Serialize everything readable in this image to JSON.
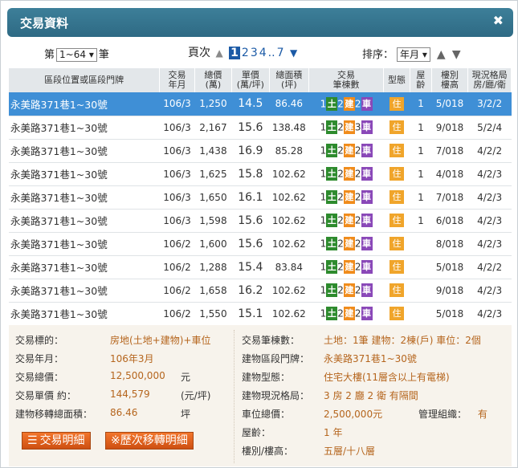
{
  "dialog": {
    "title": "交易資料",
    "close_icon": "close-icon"
  },
  "toolbar": {
    "range_prefix": "第",
    "range_value": "1~64",
    "range_suffix": "筆",
    "pages_label": "頁次",
    "pages": [
      "1",
      "2",
      "3",
      "4",
      "..",
      "7"
    ],
    "current_page": "1",
    "sort_label": "排序：",
    "sort_value": "年月"
  },
  "table": {
    "headers": {
      "address": "區段位置或區段門牌",
      "date": "交易\n年月",
      "total": "總價\n(萬)",
      "unit": "單價\n(萬/坪)",
      "area": "總面積\n(坪)",
      "counts": "交易\n筆棟數",
      "type": "型態",
      "age": "屋\n齡",
      "floor": "樓別\n樓高",
      "layout": "現況格局\n房/廳/衛"
    },
    "rows": [
      {
        "address": "永美路371巷1~30號",
        "date": "106/3",
        "total": "1,250",
        "unit": "14.5",
        "area": "86.46",
        "land": "1",
        "bld": "2",
        "car": "2",
        "type": "住",
        "age": "1",
        "floor": "5/018",
        "layout": "3/2/2",
        "selected": true
      },
      {
        "address": "永美路371巷1~30號",
        "date": "106/3",
        "total": "2,167",
        "unit": "15.6",
        "area": "138.48",
        "land": "1",
        "bld": "2",
        "car": "3",
        "type": "住",
        "age": "1",
        "floor": "9/018",
        "layout": "5/2/4",
        "selected": false
      },
      {
        "address": "永美路371巷1~30號",
        "date": "106/3",
        "total": "1,438",
        "unit": "16.9",
        "area": "85.28",
        "land": "1",
        "bld": "2",
        "car": "2",
        "type": "住",
        "age": "1",
        "floor": "7/018",
        "layout": "4/2/2",
        "selected": false
      },
      {
        "address": "永美路371巷1~30號",
        "date": "106/3",
        "total": "1,625",
        "unit": "15.8",
        "area": "102.62",
        "land": "1",
        "bld": "2",
        "car": "2",
        "type": "住",
        "age": "1",
        "floor": "4/018",
        "layout": "4/2/3",
        "selected": false
      },
      {
        "address": "永美路371巷1~30號",
        "date": "106/3",
        "total": "1,650",
        "unit": "16.1",
        "area": "102.62",
        "land": "1",
        "bld": "2",
        "car": "2",
        "type": "住",
        "age": "1",
        "floor": "7/018",
        "layout": "4/2/3",
        "selected": false
      },
      {
        "address": "永美路371巷1~30號",
        "date": "106/3",
        "total": "1,598",
        "unit": "15.6",
        "area": "102.62",
        "land": "1",
        "bld": "2",
        "car": "2",
        "type": "住",
        "age": "1",
        "floor": "6/018",
        "layout": "4/2/3",
        "selected": false
      },
      {
        "address": "永美路371巷1~30號",
        "date": "106/2",
        "total": "1,600",
        "unit": "15.6",
        "area": "102.62",
        "land": "1",
        "bld": "2",
        "car": "2",
        "type": "住",
        "age": "",
        "floor": "8/018",
        "layout": "4/2/3",
        "selected": false
      },
      {
        "address": "永美路371巷1~30號",
        "date": "106/2",
        "total": "1,288",
        "unit": "15.4",
        "area": "83.84",
        "land": "1",
        "bld": "2",
        "car": "2",
        "type": "住",
        "age": "",
        "floor": "5/018",
        "layout": "4/2/2",
        "selected": false
      },
      {
        "address": "永美路371巷1~30號",
        "date": "106/2",
        "total": "1,658",
        "unit": "16.2",
        "area": "102.62",
        "land": "1",
        "bld": "2",
        "car": "2",
        "type": "住",
        "age": "",
        "floor": "9/018",
        "layout": "4/2/3",
        "selected": false
      },
      {
        "address": "永美路371巷1~30號",
        "date": "106/2",
        "total": "1,550",
        "unit": "15.1",
        "area": "102.62",
        "land": "1",
        "bld": "2",
        "car": "2",
        "type": "住",
        "age": "",
        "floor": "5/018",
        "layout": "4/2/3",
        "selected": false
      }
    ],
    "badge_letters": {
      "land": "土",
      "bld": "建",
      "car": "車"
    }
  },
  "detail": {
    "left": [
      {
        "label": "交易標的：",
        "value": "房地(土地+建物)+車位",
        "unit": ""
      },
      {
        "label": "交易年月：",
        "value": "106年3月",
        "unit": ""
      },
      {
        "label": "交易總價：",
        "value": "12,500,000",
        "unit": "元"
      },
      {
        "label": "交易單價 約：",
        "value": "144,579",
        "unit": "(元/坪)"
      },
      {
        "label": "建物移轉總面積：",
        "value": "86.46",
        "unit": "坪"
      }
    ],
    "right": [
      {
        "label": "交易筆棟數：",
        "value": "土地：1筆 建物：2棟(戶) 車位：2個"
      },
      {
        "label": "建物區段門牌：",
        "value": "永美路371巷1~30號"
      },
      {
        "label": "建物型態：",
        "value": "住宅大樓(11層含以上有電梯)"
      },
      {
        "label": "建物現況格局：",
        "value": "3 房 2 廳 2 衛 有隔間"
      },
      {
        "label": "車位總價：",
        "value": "2,500,000元"
      },
      {
        "label": "屋齡：",
        "value": "1 年"
      },
      {
        "label": "樓別/樓高：",
        "value": "五層/十八層"
      }
    ],
    "mgmt_label": "管理組織：",
    "mgmt_value": "有",
    "buttons": {
      "detail": "交易明細",
      "history": "※歷次移轉明細"
    }
  },
  "colors": {
    "title_bar": "#2e6a84",
    "selected_row": "#3f8fd6",
    "land_badge": "#2e8b2e",
    "building_badge": "#f08c1c",
    "parking_badge": "#8a48b8",
    "type_badge": "#f0a52b",
    "value_text": "#b5651d",
    "button": "#e45f1c"
  }
}
